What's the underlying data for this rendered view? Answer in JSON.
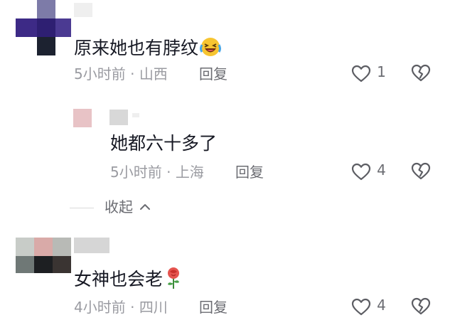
{
  "comments": [
    {
      "text": "原来她也有脖纹",
      "emoji": "laughing-crying-emoji",
      "time": "5小时前",
      "separator": "·",
      "location": "山西",
      "reply_label": "回复",
      "likes": "1"
    },
    {
      "text": "她都六十多了",
      "time": "5小时前",
      "separator": "·",
      "location": "上海",
      "reply_label": "回复",
      "likes": "4"
    },
    {
      "text": "女神也会老",
      "emoji": "rose-emoji",
      "time": "4小时前",
      "separator": "·",
      "location": "四川",
      "reply_label": "回复",
      "likes": "4"
    }
  ],
  "collapse_label": "收起",
  "icons": {
    "like": "heart-outline-icon",
    "dislike": "broken-heart-icon",
    "collapse": "chevron-up-icon"
  },
  "colors": {
    "text_primary": "#161823",
    "text_meta": "#9a9ba1",
    "text_secondary": "#6b6c72",
    "icon": "#5c5d63"
  }
}
